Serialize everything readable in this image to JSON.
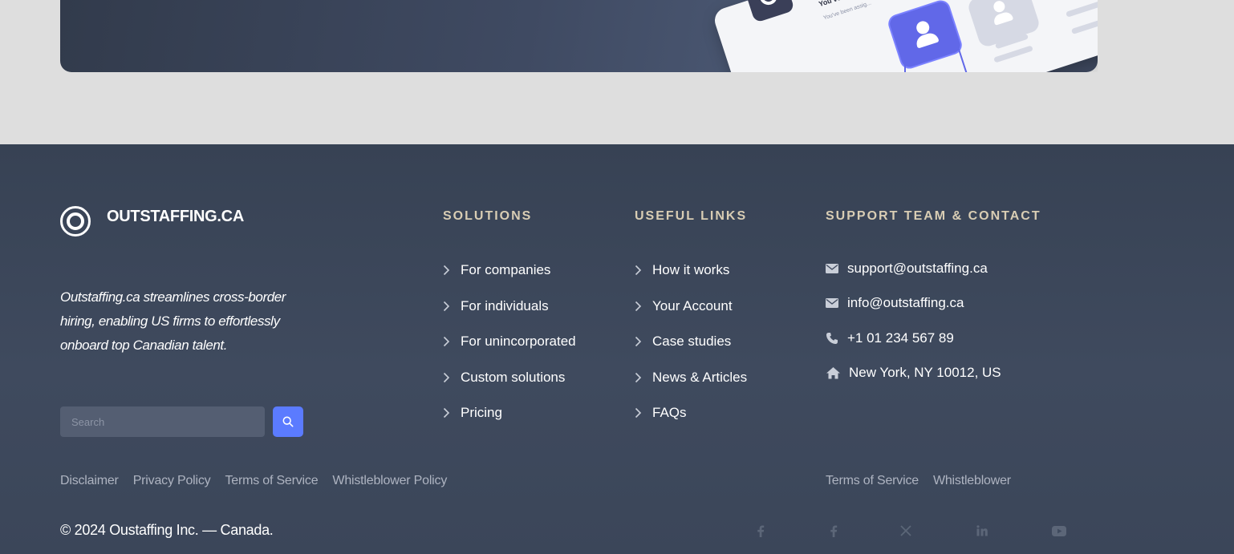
{
  "banner": {
    "mock_title": "You've",
    "mock_subtitle": "You've been assig..."
  },
  "footer": {
    "brand": {
      "name": "OUTSTAFFING.CA",
      "logo_icon": "double-ring-logo"
    },
    "tagline": "Outstaffing.ca streamlines cross-border hiring, enabling US firms to effortlessly onboard top Canadian talent.",
    "search": {
      "placeholder": "Search",
      "value": "",
      "button_icon": "search-icon"
    },
    "solutions": {
      "title": "SOLUTIONS",
      "items": [
        {
          "label": "For companies"
        },
        {
          "label": "For individuals"
        },
        {
          "label": "For unincorporated"
        },
        {
          "label": "Custom solutions"
        },
        {
          "label": "Pricing"
        }
      ]
    },
    "useful_links": {
      "title": "USEFUL LINKS",
      "items": [
        {
          "label": "How it works"
        },
        {
          "label": "Your Account"
        },
        {
          "label": "Case studies"
        },
        {
          "label": "News & Articles"
        },
        {
          "label": "FAQs"
        }
      ]
    },
    "contact": {
      "title": "SUPPORT TEAM & CONTACT",
      "items": [
        {
          "icon": "envelope-icon",
          "text": "support@outstaffing.ca"
        },
        {
          "icon": "envelope-icon",
          "text": "info@outstaffing.ca"
        },
        {
          "icon": "phone-icon",
          "text": "+1 01 234 567 89"
        },
        {
          "icon": "home-icon",
          "text": "New York, NY 10012, US"
        }
      ]
    },
    "legal_left": [
      {
        "label": "Disclaimer"
      },
      {
        "label": "Privacy Policy"
      },
      {
        "label": "Terms of Service"
      },
      {
        "label": "Whistleblower Policy"
      }
    ],
    "legal_right": [
      {
        "label": "Terms of Service"
      },
      {
        "label": "Whistleblower"
      }
    ],
    "copyright": "© 2024 Oustaffing Inc. — Canada.",
    "social": [
      {
        "icon": "facebook-icon"
      },
      {
        "icon": "facebook-icon"
      },
      {
        "icon": "x-twitter-icon"
      },
      {
        "icon": "linkedin-icon"
      },
      {
        "icon": "youtube-icon"
      }
    ],
    "colors": {
      "background": "#3b4659",
      "heading": "#d9cdb4",
      "accent": "#5b7bff",
      "muted": "#aeb4c1"
    }
  }
}
